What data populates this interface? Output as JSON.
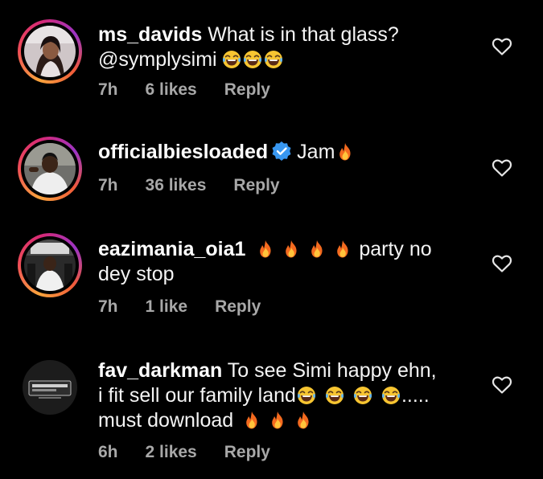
{
  "comments": [
    {
      "username": "ms_davids",
      "line1": "What is in that glass?",
      "line2": "@symplysimi",
      "time": "7h",
      "likes": "6 likes",
      "reply": "Reply",
      "emojis": [
        "face-with-tears-of-joy",
        "face-with-tears-of-joy",
        "face-with-tears-of-joy"
      ]
    },
    {
      "username": "officialbiesloaded",
      "verified": true,
      "text": "Jam",
      "time": "7h",
      "likes": "36 likes",
      "reply": "Reply",
      "emojis": [
        "fire"
      ]
    },
    {
      "username": "eazimania_oia1",
      "text_after": "party no",
      "line2": "dey stop",
      "time": "7h",
      "likes": "1 like",
      "reply": "Reply",
      "emojis": [
        "fire",
        "fire",
        "fire",
        "fire"
      ]
    },
    {
      "username": "fav_darkman",
      "line1": "To see Simi happy ehn,",
      "line2a": "i fit sell our family land",
      "line2b": ".....",
      "line3": "must download",
      "time": "6h",
      "likes": "2 likes",
      "reply": "Reply",
      "emojis": [
        "face-with-tears-of-joy",
        "face-with-tears-of-joy",
        "face-with-tears-of-joy",
        "face-with-tears-of-joy",
        "fire",
        "fire",
        "fire"
      ]
    }
  ],
  "icons": {
    "like": "heart-outline-icon",
    "verified": "verified-badge-icon"
  },
  "colors": {
    "background": "#000000",
    "text": "#f4f4f4",
    "meta": "#a8a8a8",
    "verified": "#3897f0",
    "story_ring": [
      "#f9a43c",
      "#ef4d57",
      "#d62976",
      "#9b34c4"
    ]
  }
}
